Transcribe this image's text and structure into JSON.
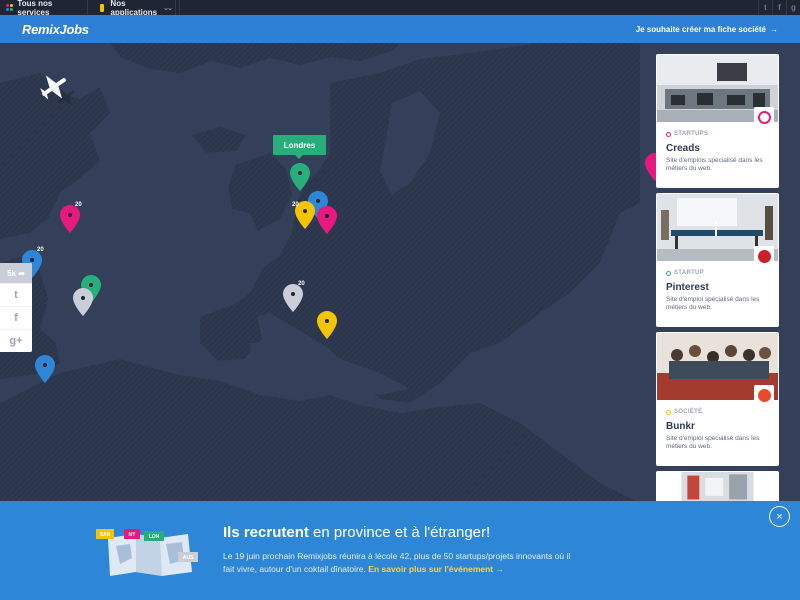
{
  "topbar": {
    "services_label": "Tous nos services",
    "apps_label": "Nos applications",
    "social_icons": [
      "twitter-icon",
      "facebook-icon",
      "google-plus-icon"
    ]
  },
  "header": {
    "logo": "RemixJobs",
    "cta_label": "Je souhaite créer ma fiche société",
    "cta_arrow": "→"
  },
  "map": {
    "tooltip": "Londres",
    "pin_counts": [
      "20",
      "20",
      "20",
      "20"
    ]
  },
  "share": {
    "count": "5k",
    "icons": [
      "twitter-icon",
      "facebook-icon",
      "google-plus-icon"
    ]
  },
  "cards": [
    {
      "type": "STARTUPS",
      "name": "Creads",
      "desc": "Site d'emplois spécialisé dans les métiers du web.",
      "type_color": "#e6197e"
    },
    {
      "type": "STARTUP",
      "name": "Pinterest",
      "desc": "Site d'emploi spécialisé dans les métiers du web.",
      "type_color": "#27ae7b"
    },
    {
      "type": "SOCIÉTÉ",
      "name": "Bunkr",
      "desc": "Site d'emploi spécialisé dans les métiers du web.",
      "type_color": "#f5c400"
    }
  ],
  "banner": {
    "title_bold": "Ils recrutent",
    "title_rest": " en province et à l'étranger!",
    "text": "Le 19 juin prochain Remixjobs réunira à lécole 42, plus de 50 startups/projets innovants où il fait vivre, autour d'un coktail dînatoire.",
    "link_label": "En savoir plus sur l'événement",
    "link_arrow": "→",
    "close_icon": "×",
    "tags": [
      "SAN",
      "NY",
      "LON",
      "AUS"
    ]
  },
  "colors": {
    "header_blue": "#2e7fd6",
    "map_bg": "#34405a",
    "land": "#2a3449",
    "green": "#27ae7b",
    "pink": "#e6197e",
    "yellow": "#f5c400",
    "blue": "#2e86d6",
    "grey": "#c9ced8"
  }
}
